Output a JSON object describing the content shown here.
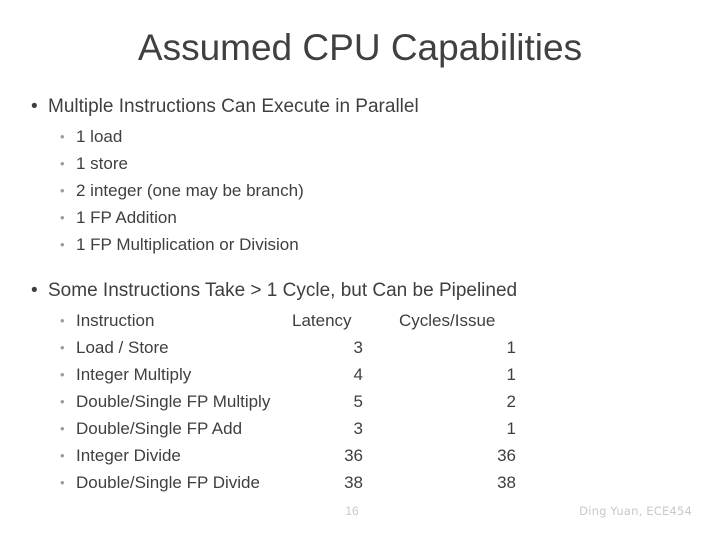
{
  "slide": {
    "title": "Assumed CPU Capabilities",
    "bullet_glyph": "•",
    "sub_bullet_glyph": "•",
    "sections": [
      {
        "heading": "Multiple Instructions Can Execute in Parallel",
        "items": [
          "1 load",
          "1 store",
          "2 integer (one may be branch)",
          "1 FP Addition",
          "1 FP Multiplication or Division"
        ]
      },
      {
        "heading": "Some Instructions Take > 1 Cycle, but Can be Pipelined"
      }
    ],
    "table": {
      "columns": [
        "Instruction",
        "Latency",
        "Cycles/Issue"
      ],
      "rows": [
        {
          "instruction": "Load / Store",
          "latency": "3",
          "cycles_issue": "1"
        },
        {
          "instruction": "Integer Multiply",
          "latency": "4",
          "cycles_issue": "1"
        },
        {
          "instruction": "Double/Single FP Multiply",
          "latency": "5",
          "cycles_issue": "2"
        },
        {
          "instruction": "Double/Single FP Add",
          "latency": "3",
          "cycles_issue": "1"
        },
        {
          "instruction": "Integer Divide",
          "latency": "36",
          "cycles_issue": "36"
        },
        {
          "instruction": "Double/Single FP Divide",
          "latency": "38",
          "cycles_issue": "38"
        }
      ]
    },
    "footer": {
      "page_number": "16",
      "credit": "Ding Yuan, ECE454"
    },
    "colors": {
      "background": "#ffffff",
      "text": "#3f3f3f",
      "title": "#404040",
      "sub_bullet": "#9a9a9a",
      "footer": "#c8c8c8"
    }
  }
}
